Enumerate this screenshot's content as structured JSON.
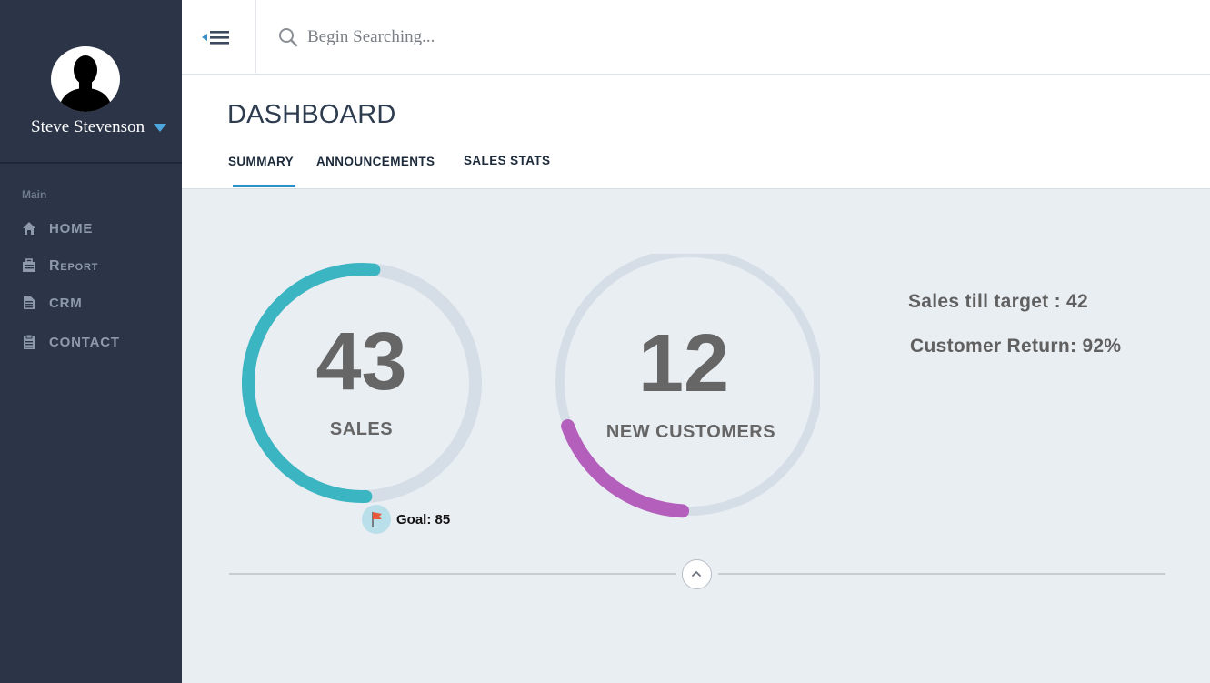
{
  "profile": {
    "name": "Steve Stevenson"
  },
  "sidebar": {
    "section_label": "Main",
    "items": [
      {
        "label": "HOME",
        "icon": "home-icon"
      },
      {
        "label": "Report",
        "icon": "briefcase-icon"
      },
      {
        "label": "CRM",
        "icon": "document-icon"
      },
      {
        "label": "CONTACT",
        "icon": "clipboard-icon"
      }
    ]
  },
  "search": {
    "placeholder": "Begin Searching..."
  },
  "header": {
    "title": "DASHBOARD",
    "tabs": [
      {
        "label": "SUMMARY",
        "active": true
      },
      {
        "label": "ANNOUNCEMENTS",
        "active": false
      },
      {
        "label": "SALES STATS",
        "active": false
      }
    ]
  },
  "sales": {
    "value": "43",
    "label": "SALES",
    "goal_text": "Goal: 85",
    "progress_fraction": 0.506
  },
  "customers": {
    "value": "12",
    "label": "NEW CUSTOMERS",
    "progress_fraction": 0.15
  },
  "stats": {
    "sales_till_target": "Sales till target : 42",
    "customer_return": "Customer Return: 92%"
  },
  "colors": {
    "sidebar_bg": "#2b3547",
    "accent_blue": "#2b8fc9",
    "sales_gauge": "#3bb5c2",
    "customers_gauge": "#b35fbb",
    "gauge_track": "#d5dee6"
  }
}
